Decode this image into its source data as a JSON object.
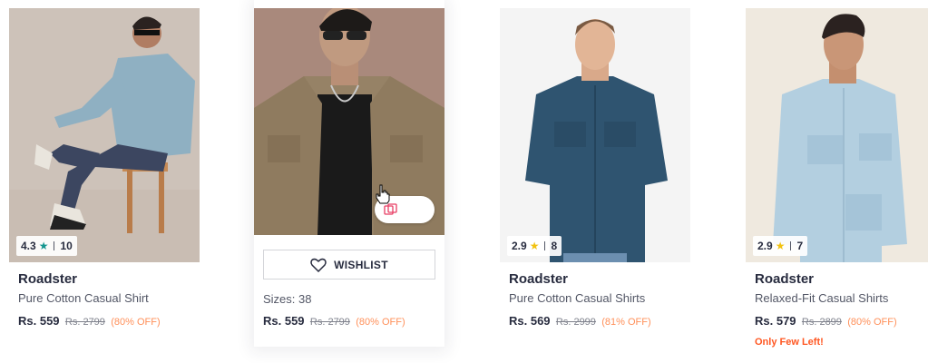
{
  "products": [
    {
      "brand": "Roadster",
      "name": "Pure Cotton Casual Shirt",
      "rating": "4.3",
      "rating_count": "10",
      "star_color": "#14958f",
      "price": "Rs. 559",
      "mrp": "Rs. 2799",
      "discount": "(80% OFF)"
    },
    {
      "wishlist_label": "WISHLIST",
      "sizes": "Sizes: 38",
      "price": "Rs. 559",
      "mrp": "Rs. 2799",
      "discount": "(80% OFF)"
    },
    {
      "brand": "Roadster",
      "name": "Pure Cotton Casual Shirts",
      "rating": "2.9",
      "rating_count": "8",
      "star_color": "#f2c210",
      "price": "Rs. 569",
      "mrp": "Rs. 2999",
      "discount": "(81% OFF)"
    },
    {
      "brand": "Roadster",
      "name": "Relaxed-Fit Casual Shirts",
      "rating": "2.9",
      "rating_count": "7",
      "star_color": "#f2c210",
      "price": "Rs. 579",
      "mrp": "Rs. 2899",
      "discount": "(80% OFF)",
      "stock_note": "Only Few Left!"
    }
  ]
}
